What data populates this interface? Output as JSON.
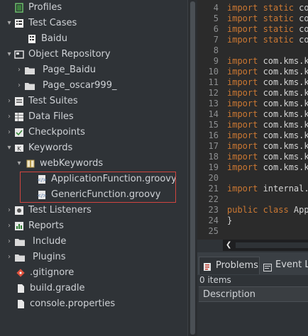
{
  "tree": {
    "items": [
      {
        "label": "Profiles",
        "arrow": "",
        "icon": "profiles-icon"
      },
      {
        "label": "Test Cases",
        "arrow": "▾",
        "icon": "test-cases-icon"
      },
      {
        "label": "Baidu",
        "arrow": "",
        "icon": "test-case-icon"
      },
      {
        "label": "Object Repository",
        "arrow": "▾",
        "icon": "object-repository-icon"
      },
      {
        "label": "Page_Baidu",
        "arrow": "›",
        "icon": "folder-icon"
      },
      {
        "label": "Page_oscar999_",
        "arrow": "›",
        "icon": "folder-icon"
      },
      {
        "label": "Test Suites",
        "arrow": "›",
        "icon": "test-suites-icon"
      },
      {
        "label": "Data Files",
        "arrow": "›",
        "icon": "data-files-icon"
      },
      {
        "label": "Checkpoints",
        "arrow": "›",
        "icon": "checkpoints-icon"
      },
      {
        "label": "Keywords",
        "arrow": "▾",
        "icon": "keywords-icon"
      },
      {
        "label": "webKeywords",
        "arrow": "▾",
        "icon": "package-icon"
      },
      {
        "label": "ApplicationFunction.groovy",
        "arrow": "",
        "icon": "groovy-file-icon"
      },
      {
        "label": "GenericFunction.groovy",
        "arrow": "",
        "icon": "groovy-file-icon"
      },
      {
        "label": "Test Listeners",
        "arrow": "›",
        "icon": "test-listeners-icon"
      },
      {
        "label": "Reports",
        "arrow": "›",
        "icon": "reports-icon"
      },
      {
        "label": "Include",
        "arrow": "›",
        "icon": "folder-icon"
      },
      {
        "label": "Plugins",
        "arrow": "›",
        "icon": "folder-icon"
      },
      {
        "label": ".gitignore",
        "arrow": "",
        "icon": "git-icon"
      },
      {
        "label": "build.gradle",
        "arrow": "",
        "icon": "file-icon"
      },
      {
        "label": "console.properties",
        "arrow": "",
        "icon": "file-icon"
      }
    ]
  },
  "editor": {
    "lines": [
      {
        "n": "4",
        "kw": "import static ",
        "rest": "com"
      },
      {
        "n": "5",
        "kw": "import static ",
        "rest": "com"
      },
      {
        "n": "6",
        "kw": "import static ",
        "rest": "com"
      },
      {
        "n": "7",
        "kw": "import static ",
        "rest": "com"
      },
      {
        "n": "8",
        "kw": "",
        "rest": ""
      },
      {
        "n": "9",
        "kw": "import ",
        "rest": "com.kms.ka"
      },
      {
        "n": "10",
        "kw": "import ",
        "rest": "com.kms.ka"
      },
      {
        "n": "11",
        "kw": "import ",
        "rest": "com.kms.ka"
      },
      {
        "n": "12",
        "kw": "import ",
        "rest": "com.kms.ka"
      },
      {
        "n": "13",
        "kw": "import ",
        "rest": "com.kms.ka"
      },
      {
        "n": "14",
        "kw": "import ",
        "rest": "com.kms.ka"
      },
      {
        "n": "15",
        "kw": "import ",
        "rest": "com.kms.ka"
      },
      {
        "n": "16",
        "kw": "import ",
        "rest": "com.kms.ka"
      },
      {
        "n": "17",
        "kw": "import ",
        "rest": "com.kms.ka"
      },
      {
        "n": "18",
        "kw": "import ",
        "rest": "com.kms.ka"
      },
      {
        "n": "19",
        "kw": "import ",
        "rest": "com.kms.ka"
      },
      {
        "n": "20",
        "kw": "",
        "rest": ""
      },
      {
        "n": "21",
        "kw": "import ",
        "rest": "internal.G"
      },
      {
        "n": "22",
        "kw": "",
        "rest": ""
      },
      {
        "n": "23",
        "kw": "public class ",
        "rest": "Appl"
      },
      {
        "n": "24",
        "kw": "",
        "rest": "}"
      },
      {
        "n": "25",
        "kw": "",
        "rest": ""
      }
    ]
  },
  "bottom_panel": {
    "tabs": [
      {
        "label": "Problems",
        "icon": "problems-icon"
      },
      {
        "label": "Event Lo",
        "icon": "event-log-icon"
      }
    ],
    "items_count": "0 items",
    "column_header": "Description"
  },
  "colors": {
    "keyword": "#cc7832",
    "selection_border": "#d0453f",
    "panel_bg": "#2f3337",
    "editor_bg": "#2b2b2b"
  }
}
